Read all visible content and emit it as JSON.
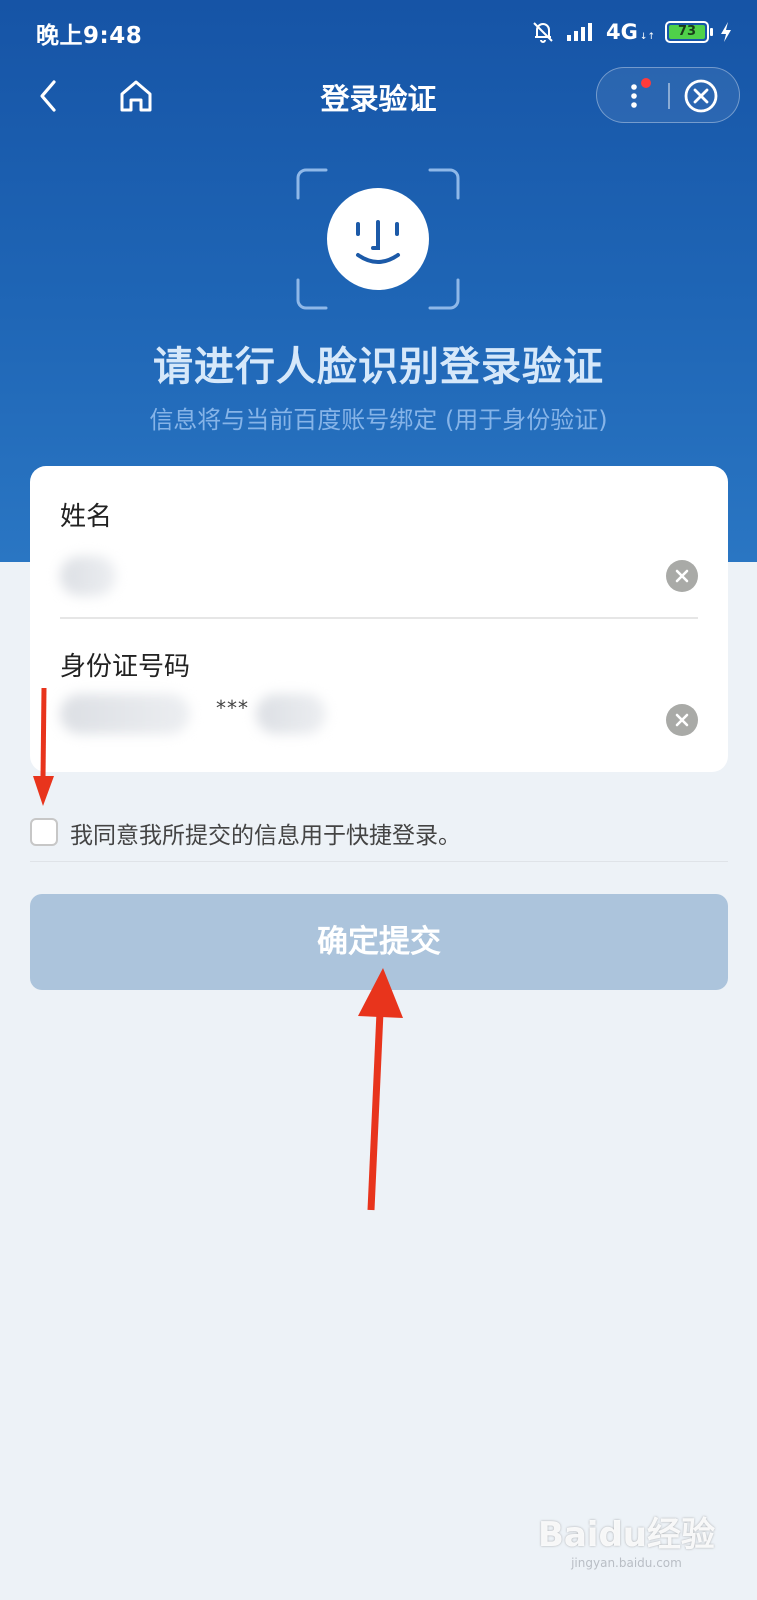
{
  "status_bar": {
    "time": "晚上9:48",
    "network": "4G",
    "network_sub": "↓↑",
    "battery": "73",
    "icons": [
      "mute-bell-icon",
      "signal-icon",
      "battery-icon",
      "charging-icon"
    ]
  },
  "nav": {
    "title": "登录验证",
    "icons": [
      "back-arrow-icon",
      "home-icon",
      "more-dots-icon",
      "close-circle-icon"
    ],
    "badge_color": "#ff3b3b"
  },
  "hero": {
    "title": "请进行人脸识别登录验证",
    "subtitle": "信息将与当前百度账号绑定 (用于身份验证)"
  },
  "form": {
    "name_label": "姓名",
    "id_label": "身份证号码",
    "id_mask": "***"
  },
  "agreement": {
    "text": "我同意我所提交的信息用于快捷登录。"
  },
  "submit": {
    "label": "确定提交"
  },
  "watermark": {
    "main": "Baidu经验",
    "sub": "jingyan.baidu.com"
  },
  "colors": {
    "header_top": "#1654a6",
    "header_bottom": "#2a76c3",
    "button_disabled": "#acc4dc",
    "annotation_arrow": "#e8341c"
  }
}
